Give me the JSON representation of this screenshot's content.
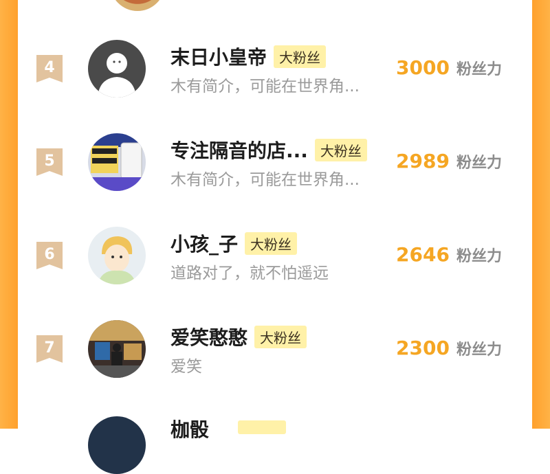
{
  "colors": {
    "frame": "#ffa22e",
    "badge": "#e2c39e",
    "fans_value": "#f5a623",
    "tag_bg": "#fff1a8"
  },
  "rows": [
    {
      "rank": "4",
      "name": "末日小皇帝",
      "tag": "大粉丝",
      "bio": "木有简介，可能在世界角...",
      "value": "3000",
      "unit": "粉丝力",
      "avatar": "default-user-avatar"
    },
    {
      "rank": "5",
      "name": "专注隔音的店...",
      "tag": "大粉丝",
      "bio": "木有简介，可能在世界角...",
      "value": "2989",
      "unit": "粉丝力",
      "avatar": "product-avatar"
    },
    {
      "rank": "6",
      "name": "小孩_子",
      "tag": "大粉丝",
      "bio": "道路对了，就不怕遥远",
      "value": "2646",
      "unit": "粉丝力",
      "avatar": "cartoon-boy-avatar"
    },
    {
      "rank": "7",
      "name": "爱笑憨憨",
      "tag": "大粉丝",
      "bio": "爱笑",
      "value": "2300",
      "unit": "粉丝力",
      "avatar": "photo-avatar"
    }
  ],
  "partial_next": {
    "name": "枷骰"
  }
}
